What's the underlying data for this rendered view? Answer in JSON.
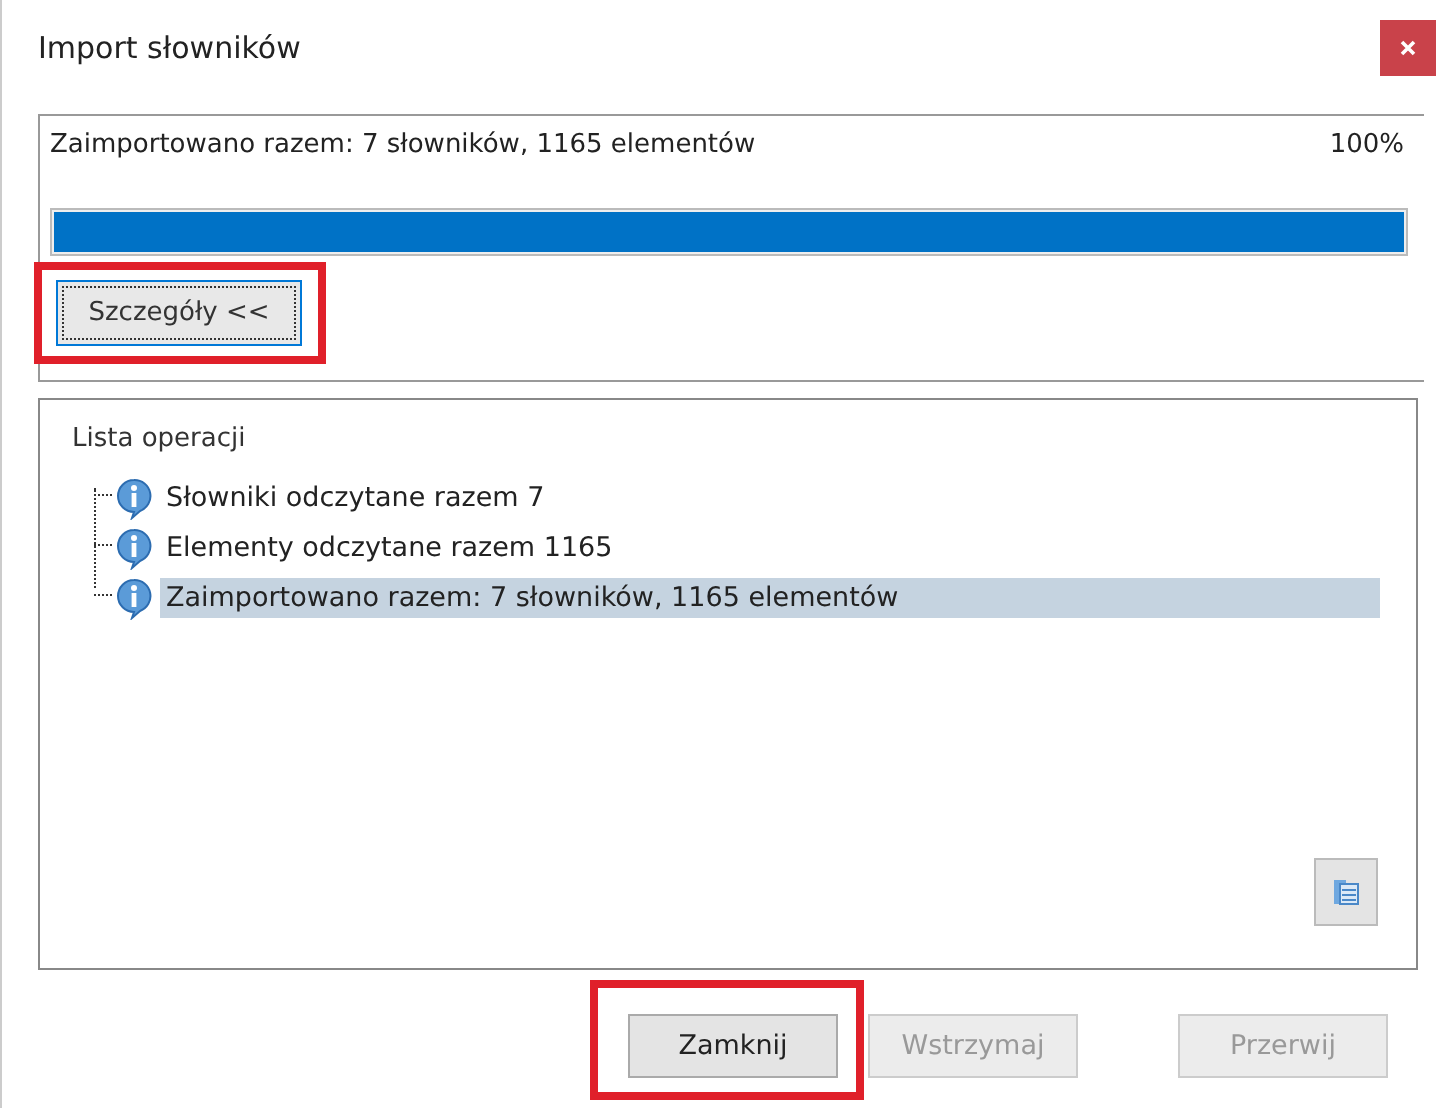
{
  "window": {
    "title": "Import słowników"
  },
  "progress": {
    "message": "Zaimportowano razem: 7 słowników, 1165 elementów",
    "percent": "100%",
    "level": 1
  },
  "details_button": {
    "label": "Szczegóły <<",
    "highlighted": true
  },
  "operations": {
    "legend": "Lista operacji",
    "items": [
      {
        "text": "Słowniki odczytane razem 7",
        "selected": false
      },
      {
        "text": "Elementy odczytane razem 1165",
        "selected": false
      },
      {
        "text": "Zaimportowano razem: 7 słowników, 1165 elementów",
        "selected": true
      }
    ]
  },
  "buttons": [
    {
      "label": "Zamknij",
      "disabled": false,
      "highlighted": true
    },
    {
      "label": "Wstrzymaj",
      "disabled": true,
      "highlighted": false
    },
    {
      "label": "Przerwij",
      "disabled": true,
      "highlighted": false
    }
  ]
}
